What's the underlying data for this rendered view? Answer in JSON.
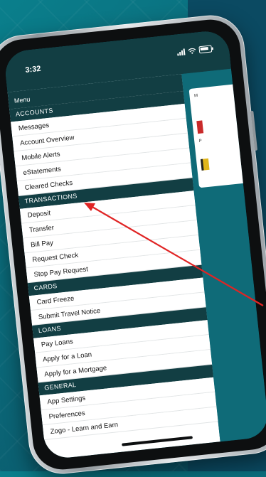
{
  "status": {
    "time": "3:32"
  },
  "menu": {
    "title": "Menu",
    "sections": [
      {
        "title": "ACCOUNTS",
        "items": [
          "Messages",
          "Account Overview",
          "Mobile Alerts",
          "eStatements",
          "Cleared Checks"
        ]
      },
      {
        "title": "TRANSACTIONS",
        "items": [
          "Deposit",
          "Transfer",
          "Bill Pay",
          "Request Check",
          "Stop Pay Request"
        ]
      },
      {
        "title": "CARDS",
        "items": [
          "Card Freeze",
          "Submit Travel Notice"
        ]
      },
      {
        "title": "LOANS",
        "items": [
          "Pay Loans",
          "Apply for a Loan",
          "Apply for a Mortgage"
        ]
      },
      {
        "title": "GENERAL",
        "items": [
          "App Settings",
          "Preferences",
          "Zogo - Learn and Earn"
        ]
      }
    ]
  },
  "right_pane": {
    "header": "M",
    "caption": "P"
  },
  "colors": {
    "menu_header": "#123e43",
    "teal": "#0f6b78",
    "arrow": "#e02424"
  },
  "icons": [
    "signal-icon",
    "wifi-icon",
    "battery-icon",
    "arrow-annotation-icon"
  ]
}
